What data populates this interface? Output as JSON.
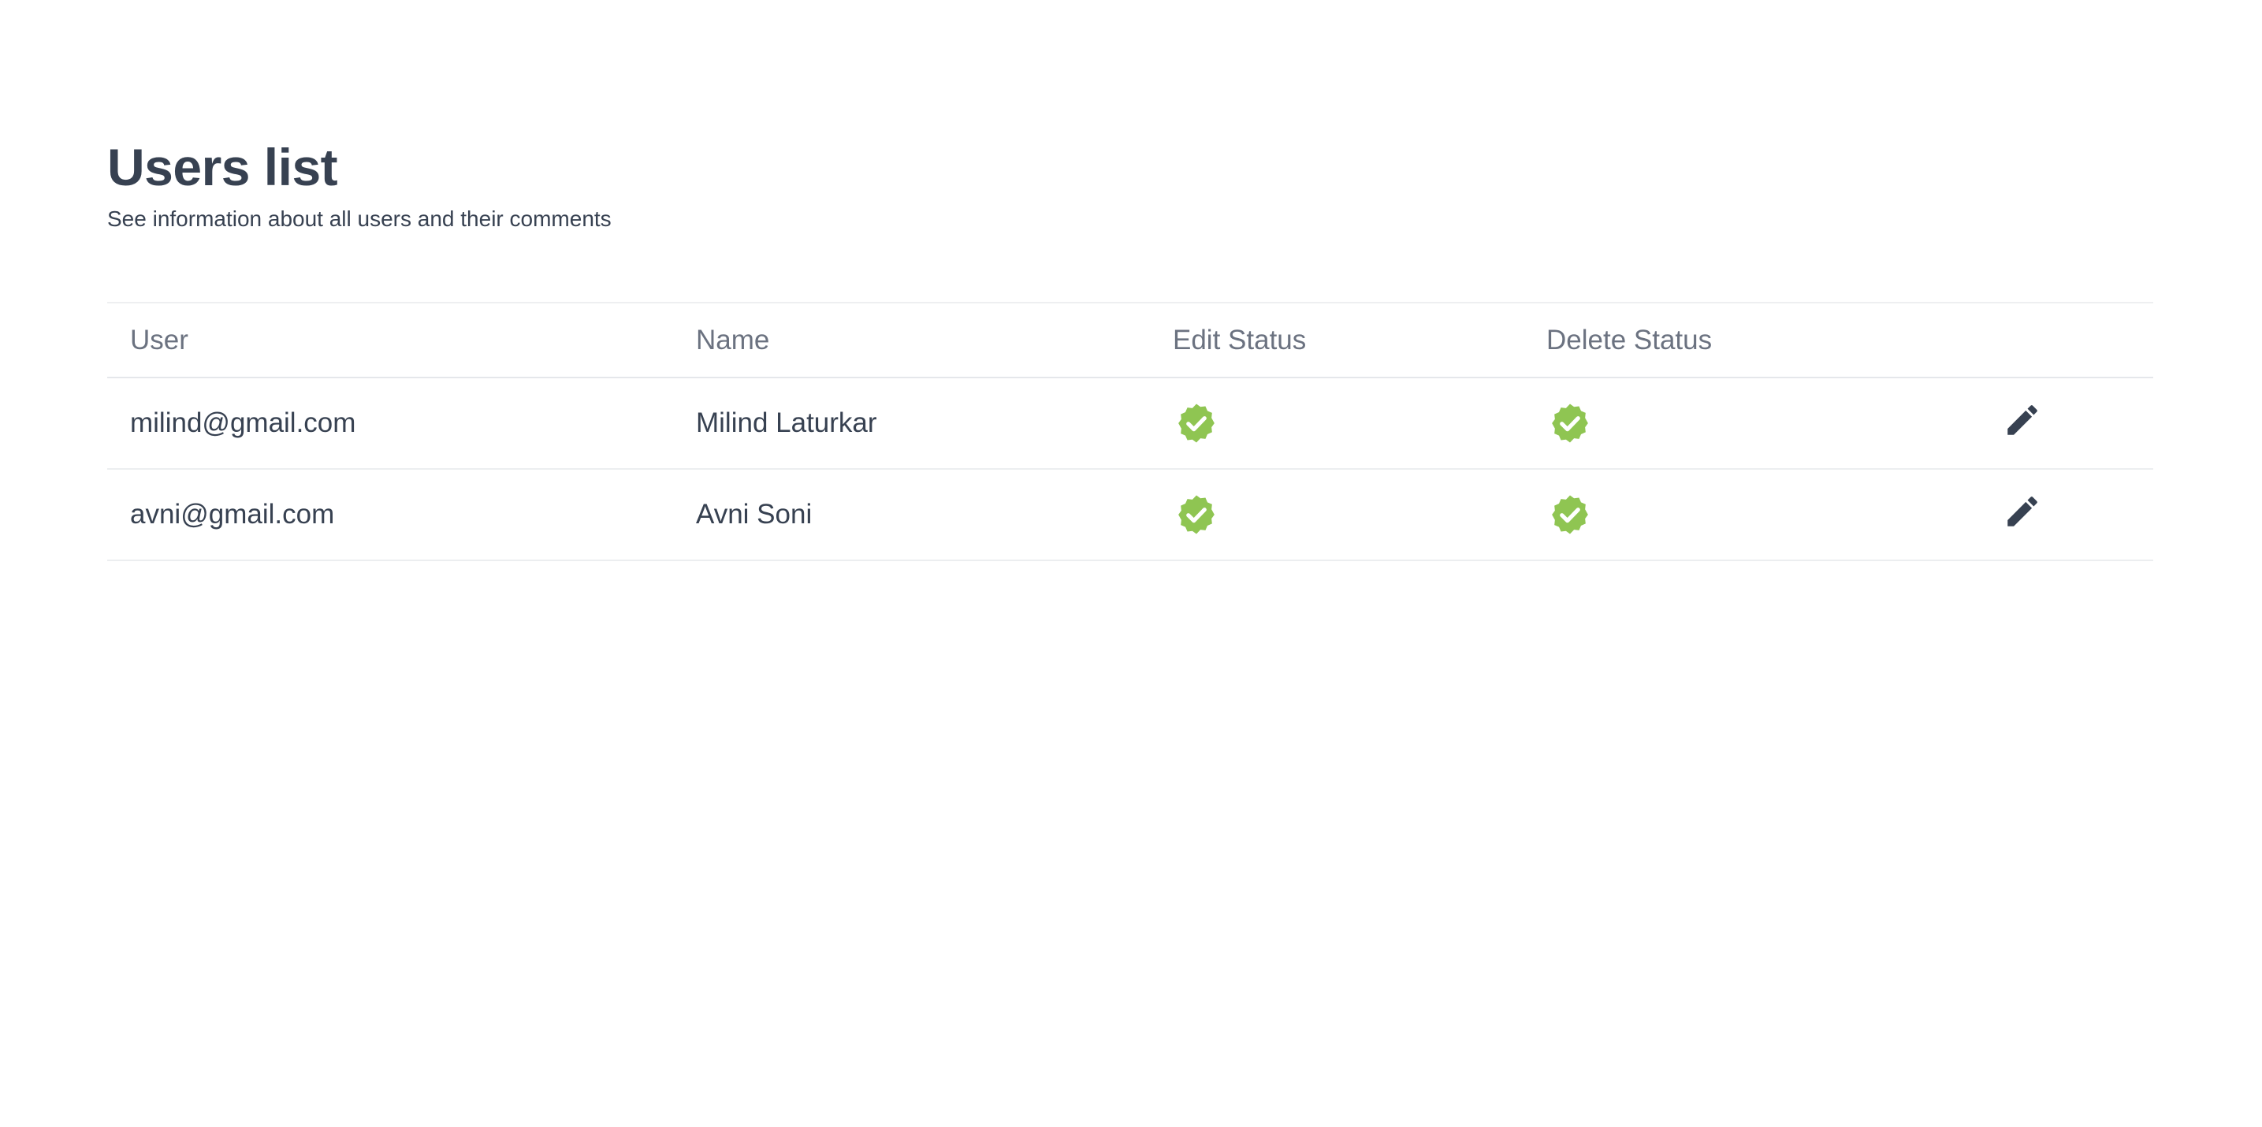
{
  "header": {
    "title": "Users list",
    "subtitle": "See information about all users and their comments"
  },
  "table": {
    "columns": [
      "User",
      "Name",
      "Edit Status",
      "Delete Status",
      ""
    ],
    "rows": [
      {
        "user": "milind@gmail.com",
        "name": "Milind Laturkar",
        "edit_status_icon": "verified-badge-icon",
        "delete_status_icon": "verified-badge-icon",
        "action_icon": "pencil-icon"
      },
      {
        "user": "avni@gmail.com",
        "name": "Avni Soni",
        "edit_status_icon": "verified-badge-icon",
        "delete_status_icon": "verified-badge-icon",
        "action_icon": "pencil-icon"
      }
    ]
  },
  "colors": {
    "text_primary": "#374151",
    "text_muted": "#6b7280",
    "status_green": "#8fc552",
    "border": "#e5e7eb"
  }
}
